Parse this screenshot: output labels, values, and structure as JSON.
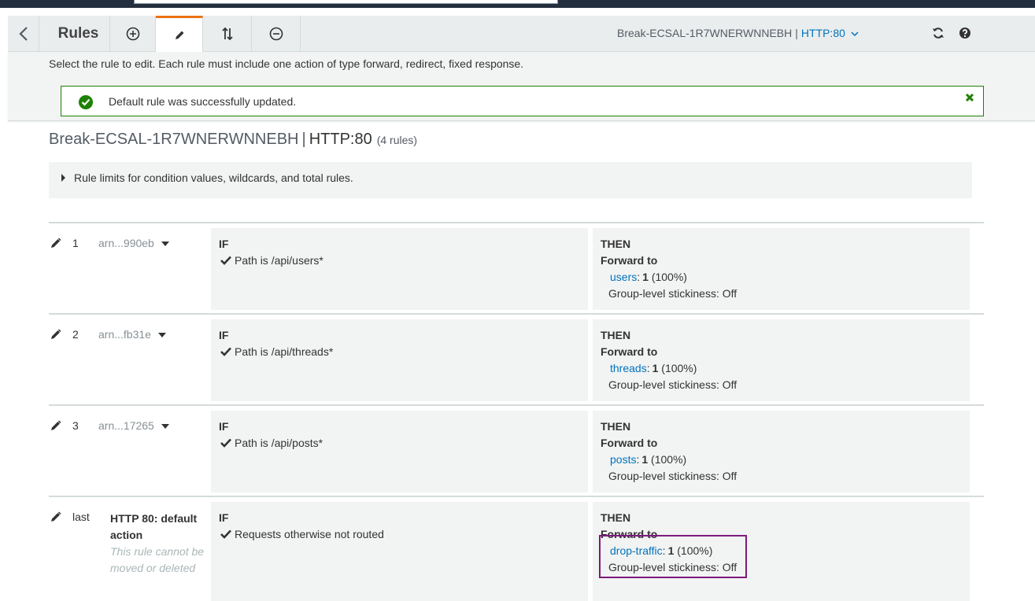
{
  "toolbar": {
    "title": "Rules",
    "load_balancer": "Break-ECSAL-1R7WNERWNNEBH",
    "separator": "|",
    "listener": "HTTP:80"
  },
  "instructions": "Select the rule to edit. Each rule must include one action of type forward, redirect, fixed response.",
  "alert": {
    "message": "Default rule was successfully updated."
  },
  "header": {
    "load_balancer": "Break-ECSAL-1R7WNERWNNEBH",
    "separator": "|",
    "listener": "HTTP:80",
    "count": "(4 rules)"
  },
  "limits": {
    "label": "Rule limits for condition values, wildcards, and total rules."
  },
  "labels": {
    "if": "IF",
    "then": "THEN",
    "forward_to": "Forward to"
  },
  "rules": [
    {
      "number": "1",
      "arn": "arn...990eb",
      "condition": "Path is  /api/users*",
      "target_group": "users",
      "sep": ":",
      "weight": "1",
      "percent": "(100%)",
      "stickiness": "Group-level stickiness: Off"
    },
    {
      "number": "2",
      "arn": "arn...fb31e",
      "condition": "Path is  /api/threads*",
      "target_group": "threads",
      "sep": ":",
      "weight": "1",
      "percent": "(100%)",
      "stickiness": "Group-level stickiness: Off"
    },
    {
      "number": "3",
      "arn": "arn...17265",
      "condition": "Path is  /api/posts*",
      "target_group": "posts",
      "sep": ":",
      "weight": "1",
      "percent": "(100%)",
      "stickiness": "Group-level stickiness: Off"
    }
  ],
  "default_rule": {
    "number": "last",
    "title": "HTTP 80: default action",
    "note": "This rule cannot be moved or deleted",
    "condition": "Requests otherwise not routed",
    "target_group": "drop-traffic",
    "sep": ":",
    "weight": "1",
    "percent": "(100%)",
    "stickiness": "Group-level stickiness: Off"
  },
  "colors": {
    "link": "#0073bb",
    "success": "#1d8102",
    "active_tab": "#ec7211",
    "highlight": "#7d1a7d"
  }
}
